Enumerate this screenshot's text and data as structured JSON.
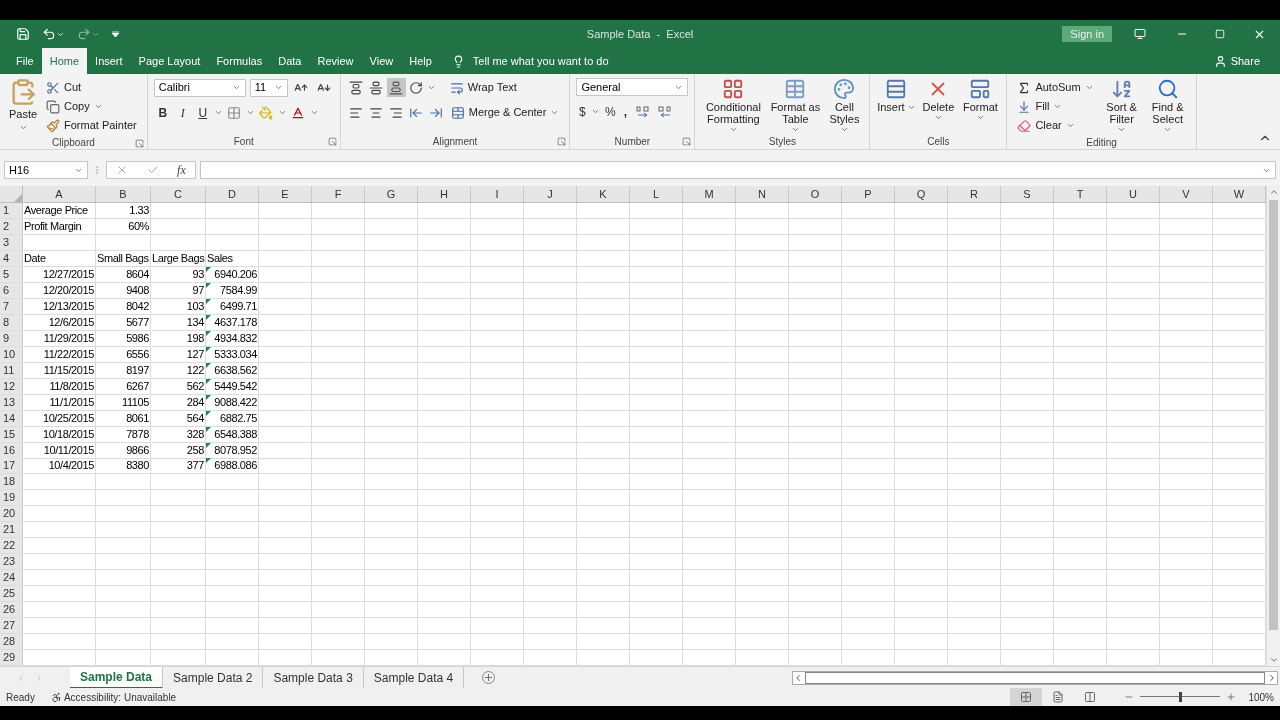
{
  "window": {
    "title": "Sample Data  -  Excel",
    "sign_in": "Sign in"
  },
  "ribbon_tabs": [
    {
      "label": "File",
      "selected": false
    },
    {
      "label": "Home",
      "selected": true
    },
    {
      "label": "Insert",
      "selected": false
    },
    {
      "label": "Page Layout",
      "selected": false
    },
    {
      "label": "Formulas",
      "selected": false
    },
    {
      "label": "Data",
      "selected": false
    },
    {
      "label": "Review",
      "selected": false
    },
    {
      "label": "View",
      "selected": false
    },
    {
      "label": "Help",
      "selected": false
    }
  ],
  "tell_me": {
    "placeholder": "Tell me what you want to do"
  },
  "share": "Share",
  "ribbon": {
    "clipboard": {
      "label": "Clipboard",
      "launcher": true,
      "paste": "Paste",
      "cut": "Cut",
      "copy": "Copy",
      "format_painter": "Format Painter"
    },
    "font": {
      "label": "Font",
      "launcher": true,
      "font_name": "Calibri",
      "font_size": "11",
      "bold": "B",
      "italic": "I",
      "underline": "U"
    },
    "alignment": {
      "label": "Alignment",
      "launcher": true,
      "wrap_text": "Wrap Text",
      "merge": "Merge & Center"
    },
    "number": {
      "label": "Number",
      "launcher": true,
      "format": "General",
      "currency": "$",
      "percent": "%",
      "comma": ","
    },
    "styles": {
      "label": "Styles",
      "launcher": false,
      "buttons": [
        "Conditional Formatting",
        "Format as Table",
        "Cell Styles"
      ]
    },
    "cells": {
      "label": "Cells",
      "launcher": false,
      "buttons": [
        "Insert",
        "Delete",
        "Format"
      ]
    },
    "editing": {
      "label": "Editing",
      "launcher": false,
      "autosum": "AutoSum",
      "fill": "Fill",
      "clear": "Clear",
      "sort": "Sort & Filter",
      "find": "Find & Select"
    }
  },
  "formula_bar": {
    "name_box": "H16",
    "function_symbol": "fx"
  },
  "sheet": {
    "columns": [
      "A",
      "B",
      "C",
      "D",
      "E",
      "F",
      "G",
      "H",
      "I",
      "J",
      "K",
      "L",
      "M",
      "N",
      "O",
      "P",
      "Q",
      "R",
      "S",
      "T",
      "U",
      "V",
      "W"
    ],
    "rows": [
      {
        "num": "1",
        "kind": "param",
        "flagged": false,
        "cells": [
          "Average Price",
          "1.33"
        ]
      },
      {
        "num": "2",
        "kind": "param",
        "flagged": false,
        "cells": [
          "Profit Margin",
          "60%"
        ]
      },
      {
        "num": "3",
        "kind": "blank",
        "flagged": false
      },
      {
        "num": "4",
        "kind": "header",
        "flagged": false,
        "cells": [
          "Date",
          "Small Bags",
          "Large Bags",
          "Sales"
        ]
      },
      {
        "num": "5",
        "kind": "data",
        "flagged": true,
        "cells": [
          "12/27/2015",
          "8604",
          "93",
          "6940.206"
        ]
      },
      {
        "num": "6",
        "kind": "data",
        "flagged": true,
        "cells": [
          "12/20/2015",
          "9408",
          "97",
          "7584.99"
        ]
      },
      {
        "num": "7",
        "kind": "data",
        "flagged": true,
        "cells": [
          "12/13/2015",
          "8042",
          "103",
          "6499.71"
        ]
      },
      {
        "num": "8",
        "kind": "data",
        "flagged": true,
        "cells": [
          "12/6/2015",
          "5677",
          "134",
          "4637.178"
        ]
      },
      {
        "num": "9",
        "kind": "data",
        "flagged": true,
        "cells": [
          "11/29/2015",
          "5986",
          "198",
          "4934.832"
        ]
      },
      {
        "num": "10",
        "kind": "data",
        "flagged": true,
        "cells": [
          "11/22/2015",
          "6556",
          "127",
          "5333.034"
        ]
      },
      {
        "num": "11",
        "kind": "data",
        "flagged": true,
        "cells": [
          "11/15/2015",
          "8197",
          "122",
          "6638.562"
        ]
      },
      {
        "num": "12",
        "kind": "data",
        "flagged": true,
        "cells": [
          "11/8/2015",
          "6267",
          "562",
          "5449.542"
        ]
      },
      {
        "num": "13",
        "kind": "data",
        "flagged": true,
        "cells": [
          "11/1/2015",
          "11105",
          "284",
          "9088.422"
        ]
      },
      {
        "num": "14",
        "kind": "data",
        "flagged": true,
        "cells": [
          "10/25/2015",
          "8061",
          "564",
          "6882.75"
        ]
      },
      {
        "num": "15",
        "kind": "data",
        "flagged": true,
        "cells": [
          "10/18/2015",
          "7878",
          "328",
          "6548.388"
        ]
      },
      {
        "num": "16",
        "kind": "data",
        "flagged": true,
        "cells": [
          "10/11/2015",
          "9866",
          "258",
          "8078.952"
        ]
      },
      {
        "num": "17",
        "kind": "data",
        "flagged": true,
        "cells": [
          "10/4/2015",
          "8380",
          "377",
          "6988.086"
        ]
      },
      {
        "num": "18",
        "kind": "blank",
        "flagged": false
      },
      {
        "num": "19",
        "kind": "blank",
        "flagged": false
      },
      {
        "num": "20",
        "kind": "blank",
        "flagged": false
      },
      {
        "num": "21",
        "kind": "blank",
        "flagged": false
      },
      {
        "num": "22",
        "kind": "blank",
        "flagged": false
      },
      {
        "num": "23",
        "kind": "blank",
        "flagged": false
      },
      {
        "num": "24",
        "kind": "blank",
        "flagged": false
      },
      {
        "num": "25",
        "kind": "blank",
        "flagged": false
      },
      {
        "num": "26",
        "kind": "blank",
        "flagged": false
      },
      {
        "num": "27",
        "kind": "blank",
        "flagged": false
      },
      {
        "num": "28",
        "kind": "blank",
        "flagged": false
      },
      {
        "num": "29",
        "kind": "blank",
        "flagged": false
      }
    ]
  },
  "sheet_tabs": [
    {
      "label": "Sample Data",
      "selected": true
    },
    {
      "label": "Sample Data 2",
      "selected": false
    },
    {
      "label": "Sample Data 3",
      "selected": false
    },
    {
      "label": "Sample Data 4",
      "selected": false
    }
  ],
  "status_bar": {
    "status": "Ready",
    "accessibility": "Accessibility: Unavailable",
    "views": [
      {
        "kind": "normal",
        "selected": true
      },
      {
        "kind": "page_layout",
        "selected": false
      },
      {
        "kind": "page_break",
        "selected": false
      }
    ],
    "zoom": {
      "level": 0.5,
      "reading": "100%"
    }
  }
}
